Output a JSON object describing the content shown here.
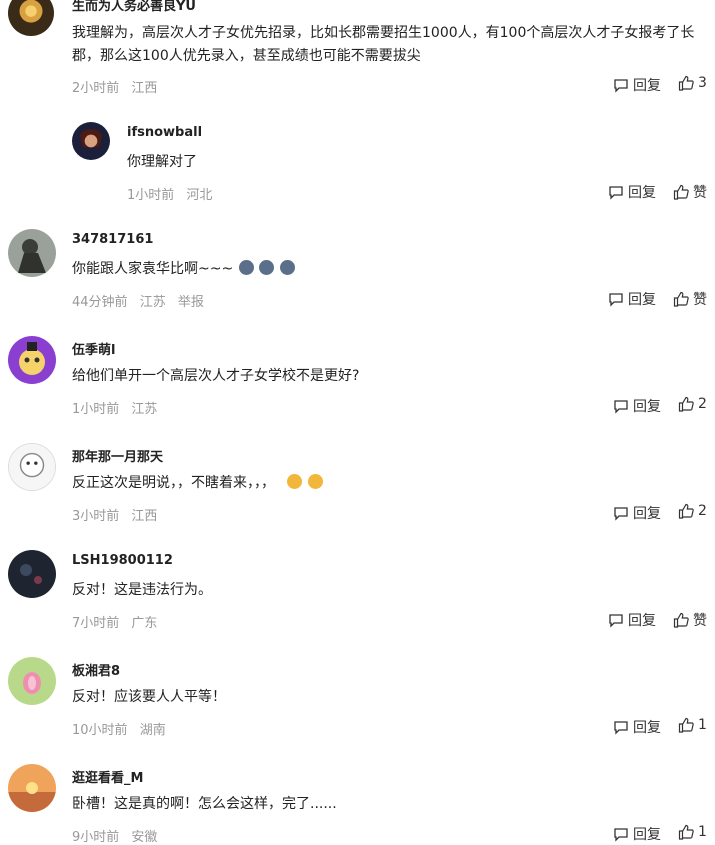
{
  "comments": [
    {
      "name": "生而为人务必善良YU",
      "text": [
        "我理解为，高层次人才子女优先招录，比如长郡需要招生1000人，有100个高层次人才子女报考了长",
        "郡，那么这100人优先录入，甚至成绩也可能不需要拔尖"
      ],
      "time": "2小时前",
      "location": "江西",
      "report": "",
      "reply_label": "回复",
      "like_label": "3"
    },
    {
      "name": "ifsnowball",
      "text": [
        "你理解对了"
      ],
      "time": "1小时前",
      "location": "河北",
      "report": "",
      "reply_label": "回复",
      "like_label": "赞"
    },
    {
      "name": "347817161",
      "text": [
        "你能跟人家袁华比啊~~~"
      ],
      "time": "44分钟前",
      "location": "江苏",
      "report": "举报",
      "reply_label": "回复",
      "like_label": "赞"
    },
    {
      "name": "伍季萌l",
      "text": [
        "给他们单开一个高层次人才子女学校不是更好?"
      ],
      "time": "1小时前",
      "location": "江苏",
      "report": "",
      "reply_label": "回复",
      "like_label": "2"
    },
    {
      "name": "那年那一月那天",
      "text": [
        "反正这次是明说，，不瞎着来，，，"
      ],
      "time": "3小时前",
      "location": "江西",
      "report": "",
      "reply_label": "回复",
      "like_label": "2"
    },
    {
      "name": "LSH19800112",
      "text": [
        "反对！这是违法行为。"
      ],
      "time": "7小时前",
      "location": "广东",
      "report": "",
      "reply_label": "回复",
      "like_label": "赞"
    },
    {
      "name": "板湘君8",
      "text": [
        "反对！应该要人人平等！"
      ],
      "time": "10小时前",
      "location": "湖南",
      "report": "",
      "reply_label": "回复",
      "like_label": "1"
    },
    {
      "name": "逛逛看看_M",
      "text": [
        "卧槽！这是真的啊！怎么会这样，完了......"
      ],
      "time": "9小时前",
      "location": "安徽",
      "report": "",
      "reply_label": "回复",
      "like_label": "1"
    }
  ]
}
